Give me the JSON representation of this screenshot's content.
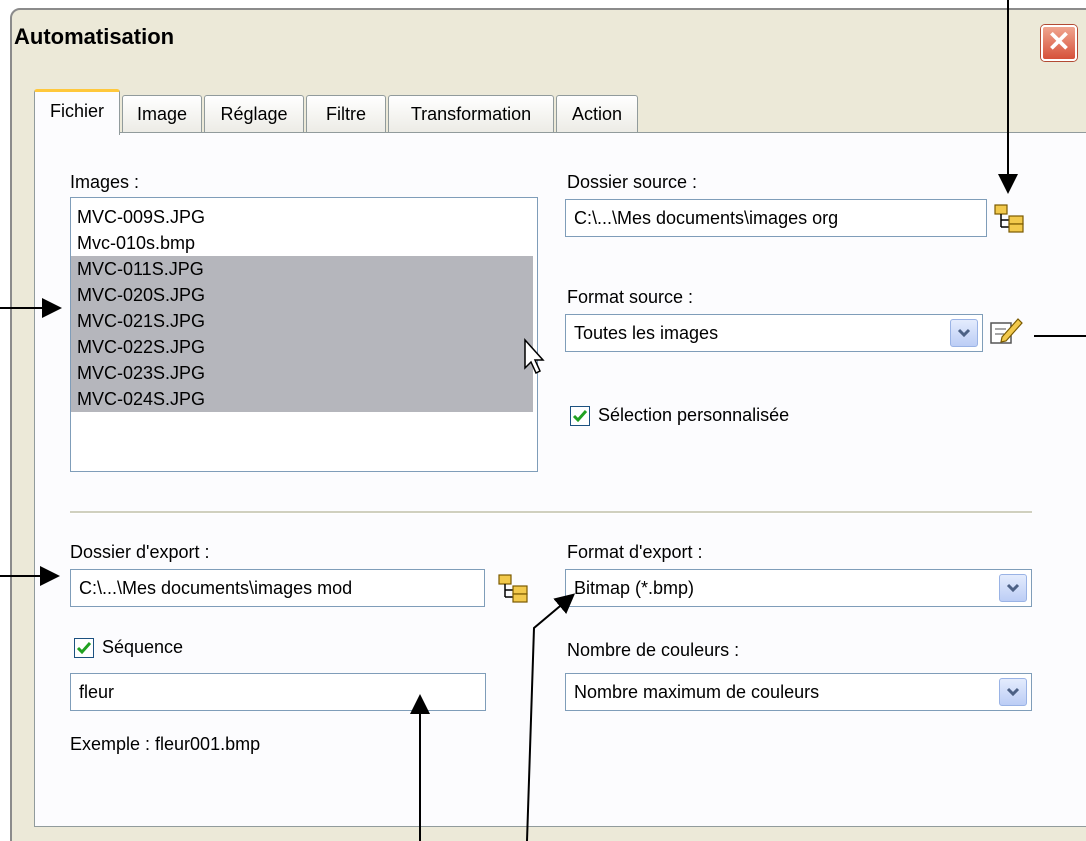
{
  "window": {
    "title": "Automatisation",
    "close_glyph": "✕"
  },
  "tabs": [
    {
      "label": "Fichier",
      "active": true
    },
    {
      "label": "Image"
    },
    {
      "label": "Réglage"
    },
    {
      "label": "Filtre"
    },
    {
      "label": "Transformation"
    },
    {
      "label": "Action"
    }
  ],
  "images": {
    "label": "Images :",
    "items": [
      {
        "name": "MVC-009S.JPG",
        "selected": false
      },
      {
        "name": "Mvc-010s.bmp",
        "selected": false
      },
      {
        "name": "MVC-011S.JPG",
        "selected": true
      },
      {
        "name": "MVC-020S.JPG",
        "selected": true
      },
      {
        "name": "MVC-021S.JPG",
        "selected": true
      },
      {
        "name": "MVC-022S.JPG",
        "selected": true
      },
      {
        "name": "MVC-023S.JPG",
        "selected": true
      },
      {
        "name": "MVC-024S.JPG",
        "selected": true
      }
    ]
  },
  "source_folder": {
    "label": "Dossier source :",
    "value": "C:\\...\\Mes documents\\images org"
  },
  "source_format": {
    "label": "Format source :",
    "value": "Toutes les images"
  },
  "custom_selection": {
    "label": "Sélection personnalisée",
    "checked": true
  },
  "export_folder": {
    "label": "Dossier d'export :",
    "value": "C:\\...\\Mes documents\\images mod"
  },
  "sequence": {
    "label": "Séquence",
    "checked": true,
    "value": "fleur",
    "example": "Exemple : fleur001.bmp"
  },
  "export_format": {
    "label": "Format d'export :",
    "value": "Bitmap (*.bmp)"
  },
  "colors": {
    "label": "Nombre de couleurs :",
    "value": "Nombre maximum de couleurs"
  },
  "icons": {
    "folder": "folder-tree-icon",
    "edit": "edit-icon",
    "check": "checkmark-icon",
    "dropdown": "chevron-down-icon",
    "cursor": "mouse-pointer-icon"
  },
  "colors_palette": {
    "window_bg": "#ece9d8",
    "panel_bg": "#fcfcfe",
    "selection": "#b5b6bc",
    "active_tab_accent": "#ffc83c",
    "close_red": "#d6513a"
  }
}
